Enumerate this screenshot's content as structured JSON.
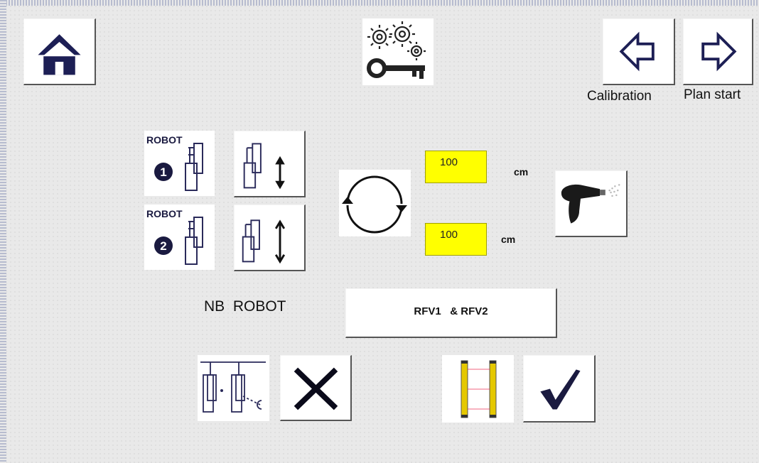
{
  "top": {
    "home_icon": "home-icon",
    "settings_icon": "gears-key-icon",
    "calibration": {
      "icon": "arrow-left-icon",
      "label": "Calibration"
    },
    "plan_start": {
      "icon": "arrow-right-icon",
      "label": "Plan start"
    }
  },
  "robots": {
    "robot1": {
      "label": "ROBOT",
      "number": "1"
    },
    "robot2": {
      "label": "ROBOT",
      "number": "2"
    }
  },
  "distances": {
    "upper": {
      "value": "100",
      "unit": "cm"
    },
    "lower": {
      "value": "100",
      "unit": "cm"
    }
  },
  "nb_robot": {
    "label": "NB  ROBOT",
    "value": "RFV1   & RFV2"
  },
  "colors": {
    "field_bg": "#ffff00",
    "panel_bg": "#e9e9e9",
    "button_bg": "#ffffff"
  }
}
